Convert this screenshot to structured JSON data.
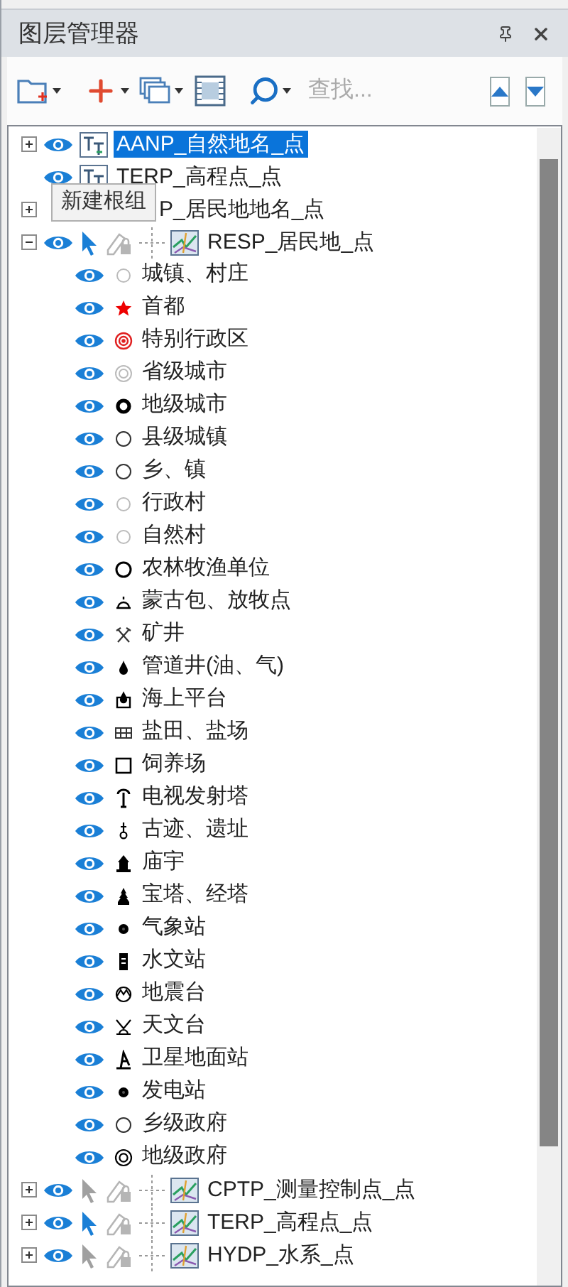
{
  "panel": {
    "title": "图层管理器"
  },
  "toolbar": {
    "search": {
      "placeholder": "查找..."
    }
  },
  "tooltip": "新建根组",
  "layers": [
    {
      "kind": "text",
      "label": "AANP_自然地名_点",
      "expandable": true,
      "expanded": false,
      "selected": true
    },
    {
      "kind": "text",
      "label": "TERP_高程点_点",
      "expandable": false,
      "selected": false
    },
    {
      "kind": "covered",
      "label": "P_居民地地名_点",
      "expandable": true,
      "expanded": false,
      "selected": false
    },
    {
      "kind": "point",
      "label": "RESP_居民地_点",
      "expandable": true,
      "expanded": true,
      "selected": false,
      "selectable": true,
      "children": [
        {
          "kind": "circle-light",
          "label": "城镇、村庄"
        },
        {
          "kind": "star",
          "label": "首都"
        },
        {
          "kind": "double-circle-red",
          "label": "特别行政区"
        },
        {
          "kind": "double-circle-light",
          "label": "省级城市"
        },
        {
          "kind": "ring-bold",
          "label": "地级城市"
        },
        {
          "kind": "circle",
          "label": "县级城镇"
        },
        {
          "kind": "circle",
          "label": "乡、镇"
        },
        {
          "kind": "circle-light",
          "label": "行政村"
        },
        {
          "kind": "circle-light",
          "label": "自然村"
        },
        {
          "kind": "circle-thick",
          "label": "农林牧渔单位"
        },
        {
          "kind": "yurt",
          "label": "蒙古包、放牧点"
        },
        {
          "kind": "pickaxe",
          "label": "矿井"
        },
        {
          "kind": "drop",
          "label": "管道井(油、气)"
        },
        {
          "kind": "platform",
          "label": "海上平台"
        },
        {
          "kind": "grid",
          "label": "盐田、盐场"
        },
        {
          "kind": "square",
          "label": "饲养场"
        },
        {
          "kind": "tower",
          "label": "电视发射塔"
        },
        {
          "kind": "ruin",
          "label": "古迹、遗址"
        },
        {
          "kind": "temple",
          "label": "庙宇"
        },
        {
          "kind": "pagoda",
          "label": "宝塔、经塔"
        },
        {
          "kind": "dot",
          "label": "气象站"
        },
        {
          "kind": "bar",
          "label": "水文站"
        },
        {
          "kind": "seismo",
          "label": "地震台"
        },
        {
          "kind": "observatory",
          "label": "天文台"
        },
        {
          "kind": "satellite",
          "label": "卫星地面站"
        },
        {
          "kind": "dot",
          "label": "发电站"
        },
        {
          "kind": "circle",
          "label": "乡级政府"
        },
        {
          "kind": "double-circle",
          "label": "地级政府"
        }
      ]
    },
    {
      "kind": "point",
      "label": "CPTP_测量控制点_点",
      "expandable": true,
      "expanded": false,
      "selected": false,
      "selectable": false
    },
    {
      "kind": "point",
      "label": "TERP_高程点_点",
      "expandable": true,
      "expanded": false,
      "selected": false,
      "selectable": true
    },
    {
      "kind": "point",
      "label": "HYDP_水系_点",
      "expandable": true,
      "expanded": false,
      "selected": false,
      "selectable": false
    }
  ]
}
